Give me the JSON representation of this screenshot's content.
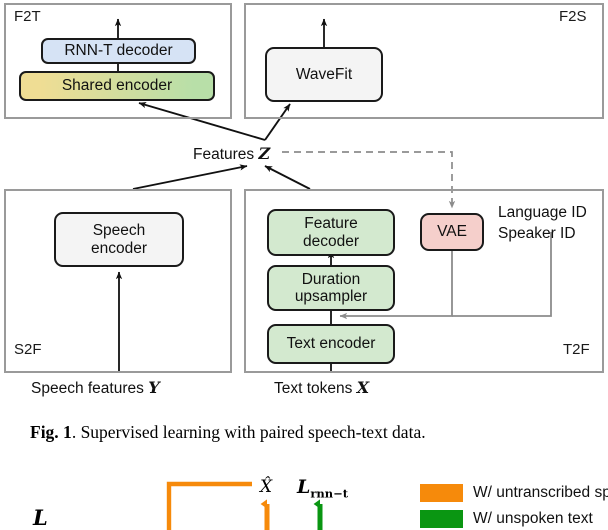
{
  "figure": {
    "panels": [
      {
        "id": "f2t",
        "tag": "F2T"
      },
      {
        "id": "f2s",
        "tag": "F2S"
      },
      {
        "id": "s2f",
        "tag": "S2F"
      },
      {
        "id": "t2f",
        "tag": "T2F"
      }
    ],
    "nodes": {
      "rnnt_decoder": "RNN-T decoder",
      "shared_encoder": "Shared encoder",
      "wavefit": "WaveFit",
      "speech_encoder": "Speech\nencoder",
      "feature_decoder": "Feature\ndecoder",
      "duration_upsampler": "Duration\nupsampler",
      "text_encoder": "Text encoder",
      "vae": "VAE"
    },
    "labels": {
      "features": "Features",
      "features_var": "Z",
      "language_id": "Language ID",
      "speaker_id": "Speaker ID",
      "speech_features": "Speech features",
      "speech_features_var": "Y",
      "text_tokens": "Text tokens",
      "text_tokens_var": "X"
    },
    "colors": {
      "rnnt_decoder": "#d6e3f5",
      "shared_encoder_left": "#efdd94",
      "shared_encoder_right": "#b8dfa8",
      "wavefit": "#f4f4f4",
      "speech_encoder": "#f4f4f4",
      "t2f_green": "#d3e9cf",
      "vae": "#f5cfcb",
      "panel_border": "#9a9a9a",
      "node_border": "#1a1a1a",
      "grey_arrow": "#8c8c8c",
      "dashed_arrow": "#8c8c8c"
    }
  },
  "caption": {
    "number": "Fig. 1",
    "text": ". Supervised learning with paired speech-text data."
  },
  "bottom_figure": {
    "x_hat": "X̂",
    "loss_symbol": "L",
    "loss_subscript": "rnn−t",
    "colors": {
      "orange": "#f68a0b",
      "green": "#0a9612"
    },
    "legend": [
      {
        "color": "#f68a0b",
        "label": "W/ untranscribed speech"
      },
      {
        "color": "#0a9612",
        "label": "W/ unspoken text"
      }
    ]
  }
}
